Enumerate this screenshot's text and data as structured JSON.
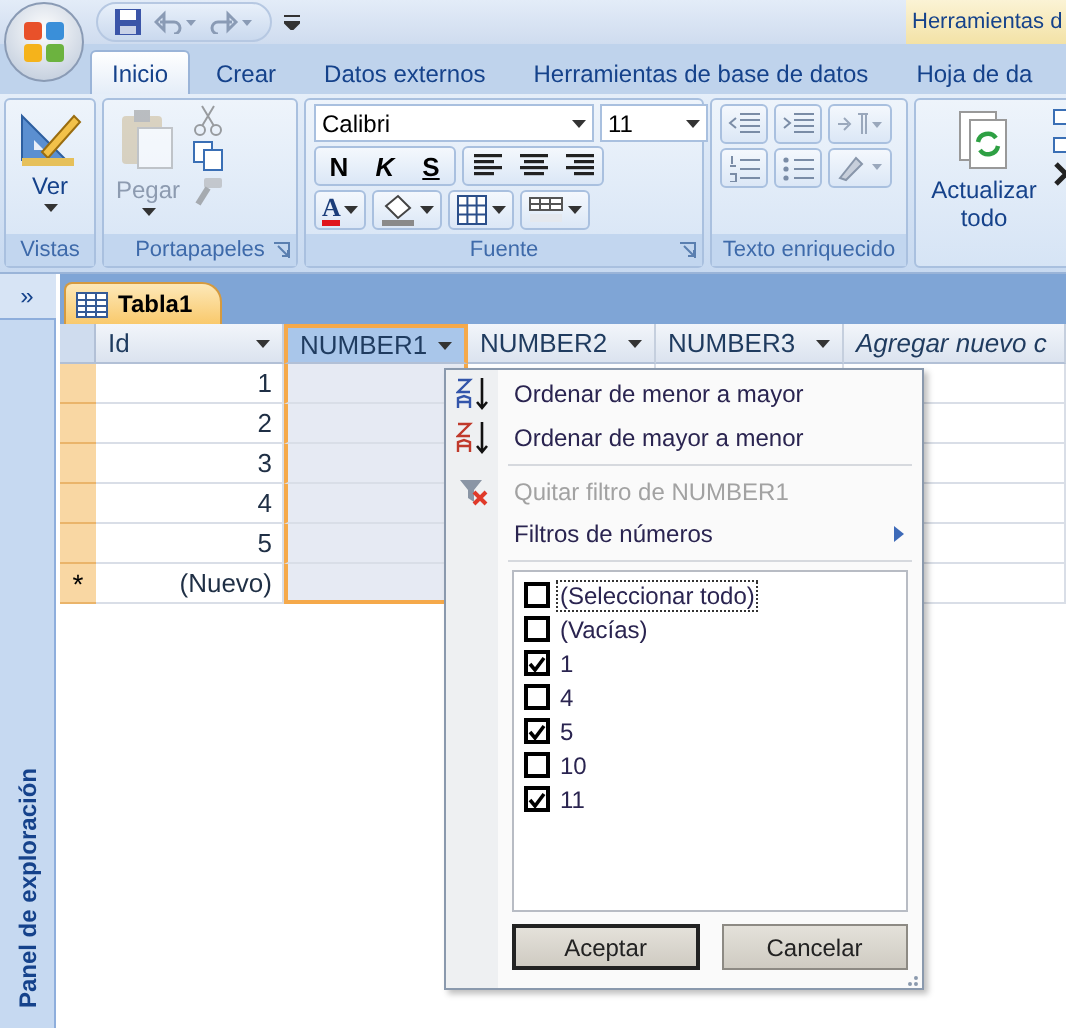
{
  "contextual_header": "Herramientas d",
  "ribbon_tabs": [
    {
      "label": "Inicio",
      "selected": true
    },
    {
      "label": "Crear",
      "selected": false
    },
    {
      "label": "Datos externos",
      "selected": false
    },
    {
      "label": "Herramientas de base de datos",
      "selected": false
    },
    {
      "label": "Hoja de da",
      "selected": false
    }
  ],
  "groups": {
    "vistas": {
      "label": "Vistas",
      "button": "Ver"
    },
    "portapapeles": {
      "label": "Portapapeles",
      "paste": {
        "label": "Pegar",
        "disabled": true
      }
    },
    "fuente": {
      "label": "Fuente",
      "font": "Calibri",
      "size": "11",
      "bold": "N",
      "italic": "K",
      "underline": "S",
      "font_color": "A"
    },
    "texto": {
      "label": "Texto enriquecido"
    },
    "datos": {
      "button": "Actualizar todo"
    }
  },
  "nav_pane": {
    "toggle": "»",
    "title": "Panel de exploración"
  },
  "doc_tab": "Tabla1",
  "columns": [
    {
      "label": "Id",
      "selected": false
    },
    {
      "label": "NUMBER1",
      "selected": true
    },
    {
      "label": "NUMBER2",
      "selected": false
    },
    {
      "label": "NUMBER3",
      "selected": false
    }
  ],
  "add_column": "Agregar nuevo c",
  "rows": [
    "1",
    "2",
    "3",
    "4",
    "5"
  ],
  "new_row": {
    "marker": "*",
    "label": "(Nuevo)"
  },
  "filter_menu": {
    "items": [
      {
        "kind": "sort_asc",
        "label": "Ordenar de menor a mayor",
        "disabled": false
      },
      {
        "kind": "sort_desc",
        "label": "Ordenar de mayor a menor",
        "disabled": false
      },
      {
        "kind": "clear",
        "label": "Quitar filtro de NUMBER1",
        "disabled": true
      },
      {
        "kind": "submenu",
        "label": "Filtros de números",
        "disabled": false
      }
    ],
    "values": [
      {
        "label": "(Seleccionar todo)",
        "checked": false,
        "focused": true
      },
      {
        "label": "(Vacías)",
        "checked": false,
        "focused": false
      },
      {
        "label": "1",
        "checked": true,
        "focused": false
      },
      {
        "label": "4",
        "checked": false,
        "focused": false
      },
      {
        "label": "5",
        "checked": true,
        "focused": false
      },
      {
        "label": "10",
        "checked": false,
        "focused": false
      },
      {
        "label": "11",
        "checked": true,
        "focused": false
      }
    ],
    "buttons": [
      {
        "label": "Aceptar",
        "default": true
      },
      {
        "label": "Cancelar",
        "default": false
      }
    ]
  }
}
